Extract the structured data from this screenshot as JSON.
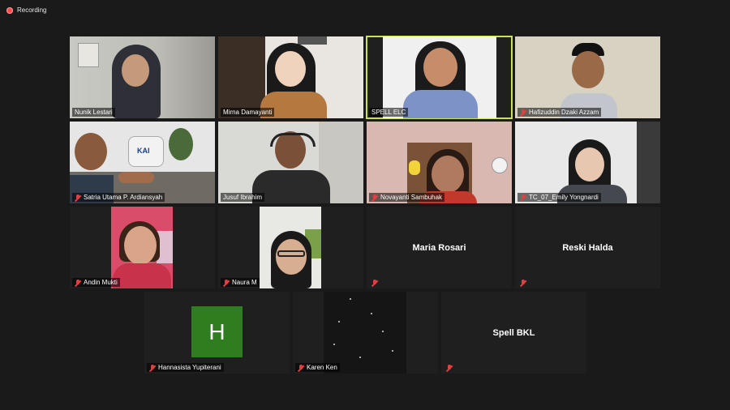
{
  "recording": {
    "label": "Recording",
    "color": "#ff4b4b"
  },
  "accent": {
    "speaker_outline": "#cde04e",
    "muted_icon": "#e04040",
    "avatar_h_bg": "#2e7d1e"
  },
  "participants": [
    {
      "name": "Nunik Lestari",
      "muted": false,
      "video": true
    },
    {
      "name": "Mirna Damayanti",
      "muted": false,
      "video": true
    },
    {
      "name": "SPELL ELC",
      "muted": false,
      "video": true,
      "active_speaker": true
    },
    {
      "name": "Hafizuddin Dzaki Azzam",
      "muted": true,
      "video": true
    },
    {
      "name": "Satria Utama P. Ardiansyah",
      "muted": true,
      "video": true
    },
    {
      "name": "Jusuf Ibrahim",
      "muted": false,
      "video": true
    },
    {
      "name": "Novayanti Sambuhak",
      "muted": true,
      "video": true
    },
    {
      "name": "TC_07_Emily Yongnardi",
      "muted": true,
      "video": true
    },
    {
      "name": "Andin Mukti",
      "muted": true,
      "video": true
    },
    {
      "name": "Naura M",
      "muted": true,
      "video": true
    },
    {
      "name": "Maria Rosari",
      "muted": true,
      "video": false
    },
    {
      "name": "Reski Halda",
      "muted": true,
      "video": false
    },
    {
      "name": "Hannasista Yupiterani",
      "muted": true,
      "video": false,
      "avatar_letter": "H"
    },
    {
      "name": "Karen Ken",
      "muted": true,
      "video": true
    },
    {
      "name": "Spell BKL",
      "muted": true,
      "video": false
    }
  ],
  "overlay_text": {
    "kai_logo": "KAI"
  }
}
